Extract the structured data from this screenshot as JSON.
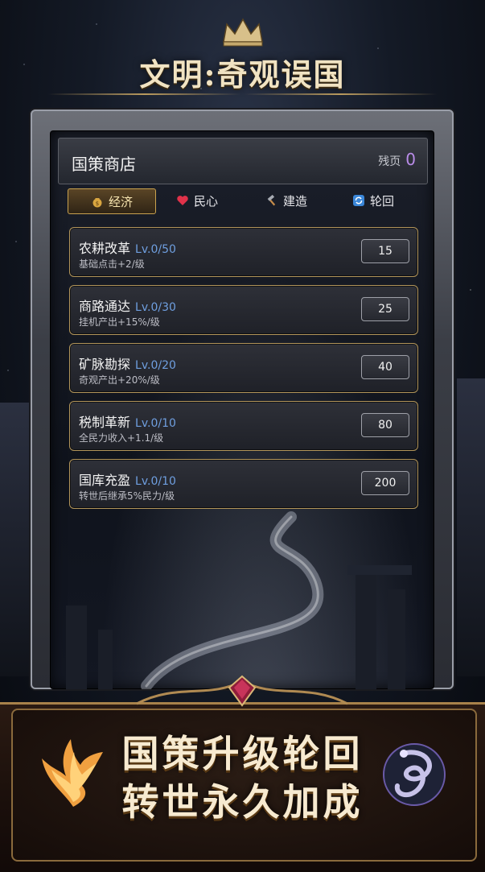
{
  "title": "文明:奇观误国",
  "shop": {
    "title": "国策商店",
    "remnant_label": "残页",
    "remnant_value": "0"
  },
  "tabs": [
    {
      "label": "经济",
      "icon": "money-bag-icon",
      "active": true
    },
    {
      "label": "民心",
      "icon": "heart-icon",
      "active": false
    },
    {
      "label": "建造",
      "icon": "hammer-icon",
      "active": false
    },
    {
      "label": "轮回",
      "icon": "cycle-icon",
      "active": false
    }
  ],
  "upgrades": [
    {
      "name": "农耕改革",
      "level": "Lv.0/50",
      "desc": "基础点击+2/级",
      "price": "15"
    },
    {
      "name": "商路通达",
      "level": "Lv.0/30",
      "desc": "挂机产出+15%/级",
      "price": "25"
    },
    {
      "name": "矿脉勘探",
      "level": "Lv.0/20",
      "desc": "奇观产出+20%/级",
      "price": "40"
    },
    {
      "name": "税制革新",
      "level": "Lv.0/10",
      "desc": "全民力收入+1.1/级",
      "price": "80"
    },
    {
      "name": "国库充盈",
      "level": "Lv.0/10",
      "desc": "转世后继承5%民力/级",
      "price": "200"
    }
  ],
  "promo": {
    "line1": "国策升级轮回",
    "line2": "转世永久加成"
  },
  "colors": {
    "gold": "#c9a24f",
    "level_blue": "#6f9fe0",
    "remnant_purple": "#b98ce8"
  }
}
